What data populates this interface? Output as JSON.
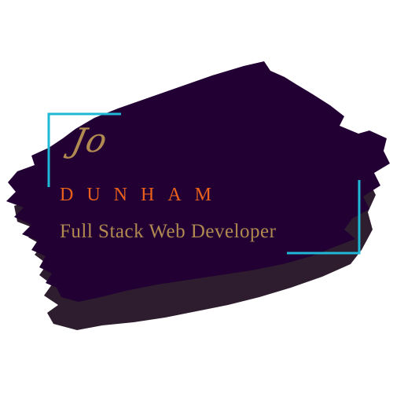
{
  "logo": {
    "first_name": "Jo",
    "last_name": "DUNHAM",
    "tagline": "Full Stack Web Developer"
  },
  "colors": {
    "background": "#ffffff",
    "brush_main": "#220033",
    "brush_shadow": "#2e1d2e",
    "frame_accent": "#1fb8d6",
    "first_name": "#b08a50",
    "last_name": "#e8601c",
    "tagline": "#b08a50"
  }
}
